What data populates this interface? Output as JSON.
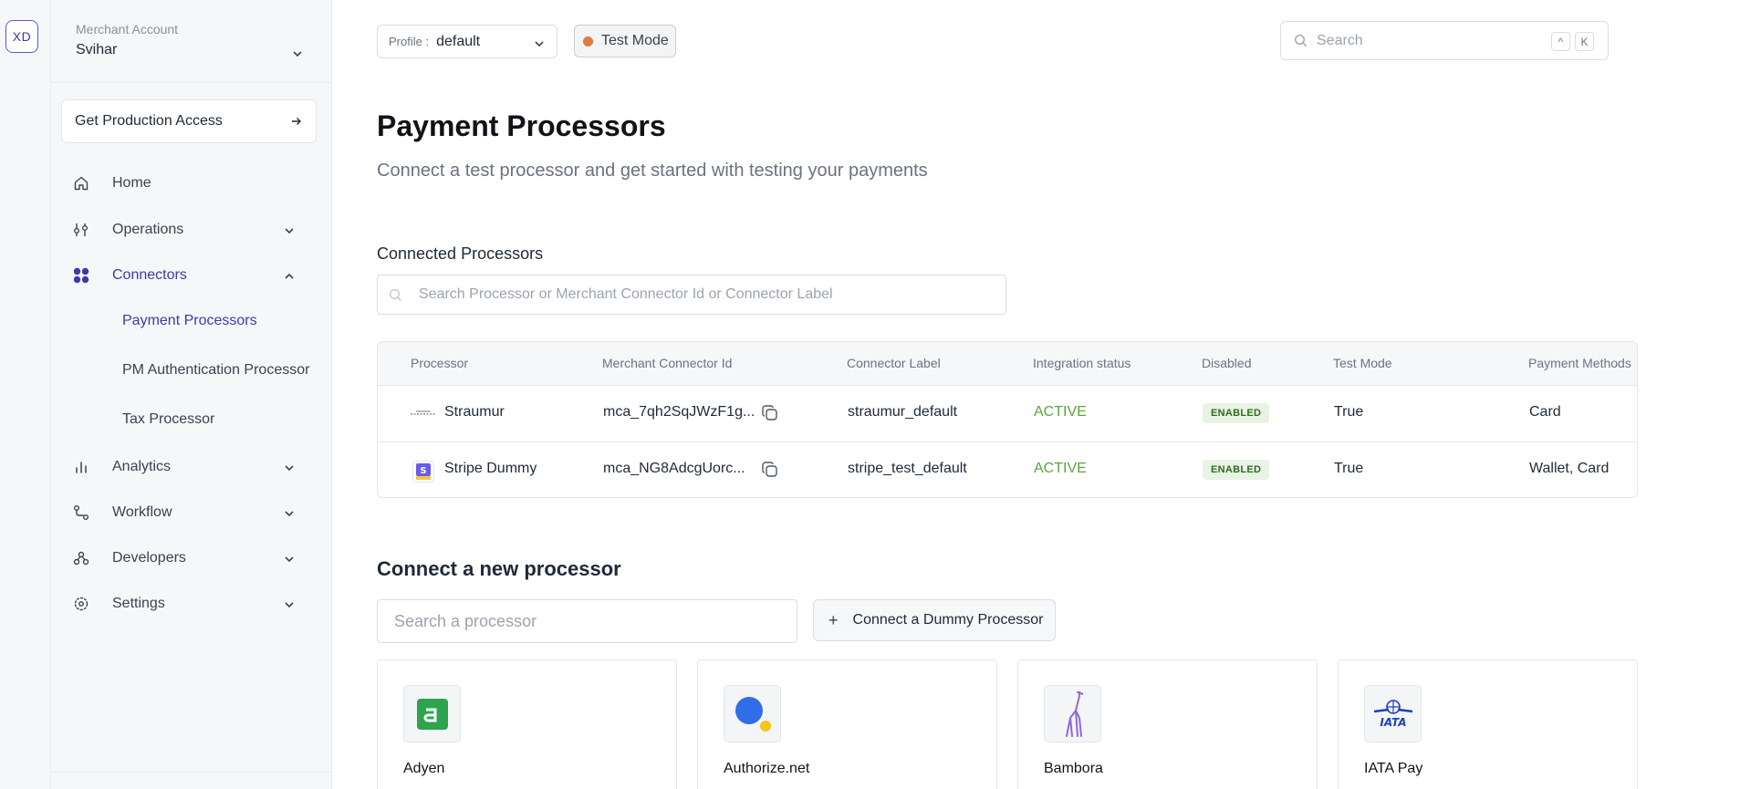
{
  "rail": {
    "avatar": "XD"
  },
  "sidebar": {
    "merchant_label": "Merchant Account",
    "merchant_name": "Svihar",
    "get_production_access": "Get Production Access",
    "items": [
      {
        "label": "Home",
        "icon": "home-icon"
      },
      {
        "label": "Operations",
        "icon": "operations-icon"
      },
      {
        "label": "Connectors",
        "icon": "connectors-icon"
      },
      {
        "label": "Analytics",
        "icon": "analytics-icon"
      },
      {
        "label": "Workflow",
        "icon": "workflow-icon"
      },
      {
        "label": "Developers",
        "icon": "developers-icon"
      },
      {
        "label": "Settings",
        "icon": "settings-icon"
      }
    ],
    "connector_sub_items": [
      "Payment Processors",
      "PM Authentication Processor",
      "Tax Processor"
    ]
  },
  "topbar": {
    "profile_label": "Profile :",
    "profile_value": "default",
    "test_mode": "Test Mode",
    "search_placeholder": "Search",
    "shortcut_keys": [
      "^",
      "K"
    ]
  },
  "main": {
    "title": "Payment Processors",
    "subtitle": "Connect a test processor and get started with testing your payments",
    "connected_title": "Connected Processors",
    "connected_search_placeholder": "Search Processor or Merchant Connector Id or Connector Label",
    "table": {
      "headers": [
        "Processor",
        "Merchant Connector Id",
        "Connector Label",
        "Integration status",
        "Disabled",
        "Test Mode",
        "Payment Methods"
      ],
      "rows": [
        {
          "processor": "Straumur",
          "merchant_connector_id": "mca_7qh2SqJWzF1g...",
          "connector_label": "straumur_default",
          "integration_status": "ACTIVE",
          "disabled": "ENABLED",
          "test_mode": "True",
          "payment_methods": "Card"
        },
        {
          "processor": "Stripe Dummy",
          "merchant_connector_id": "mca_NG8AdcgUorc...",
          "connector_label": "stripe_test_default",
          "integration_status": "ACTIVE",
          "disabled": "ENABLED",
          "test_mode": "True",
          "payment_methods": "Wallet, Card"
        }
      ]
    },
    "new_title": "Connect a new processor",
    "new_search_placeholder": "Search a processor",
    "dummy_button": "Connect a Dummy Processor",
    "cards": [
      {
        "name": "Adyen",
        "icon": "adyen-logo-icon"
      },
      {
        "name": "Authorize.net",
        "icon": "authorize-net-logo-icon"
      },
      {
        "name": "Bambora",
        "icon": "bambora-logo-icon"
      },
      {
        "name": "IATA Pay",
        "icon": "iata-logo-icon"
      }
    ]
  },
  "colors": {
    "accent": "#3e3aa8",
    "active_status": "#57a53d",
    "test_mode_dot": "#e07a3e",
    "badge_bg": "#e8f3e4"
  }
}
